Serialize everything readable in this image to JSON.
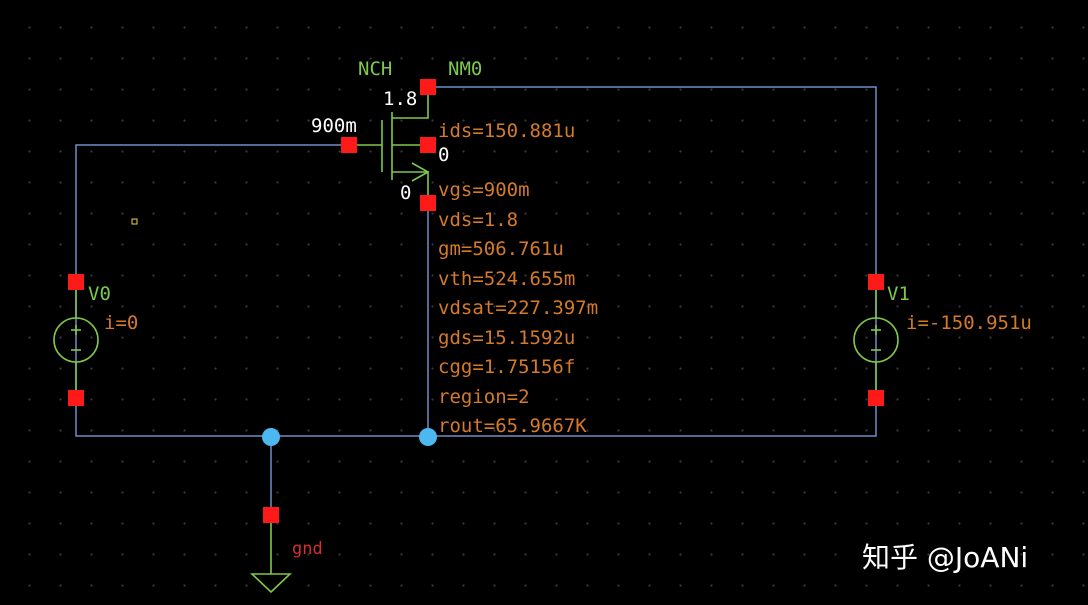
{
  "schematic": {
    "transistor": {
      "model": "NCH",
      "instance": "NM0",
      "width": "900m",
      "length": "1.8",
      "body_pin": "0",
      "source_pin": "0"
    },
    "operating_point": [
      "ids=150.881u",
      "vgs=900m",
      "vds=1.8",
      "gm=506.761u",
      "vth=524.655m",
      "vdsat=227.397m",
      "gds=15.1592u",
      "cgg=1.75156f",
      "region=2",
      "rout=65.9667K"
    ],
    "source_v0": {
      "name": "V0",
      "current": "i=0"
    },
    "source_v1": {
      "name": "V1",
      "current": "i=-150.951u"
    },
    "ground": {
      "label": "gnd"
    }
  },
  "watermark": "知乎 @JoANi",
  "colors": {
    "wire": "#6d8fc7",
    "pin": "#ff1a1a",
    "device": "#7ec84a",
    "node_dot": "#4db8f0",
    "param_text": "#d47a2a",
    "background": "#000000"
  }
}
